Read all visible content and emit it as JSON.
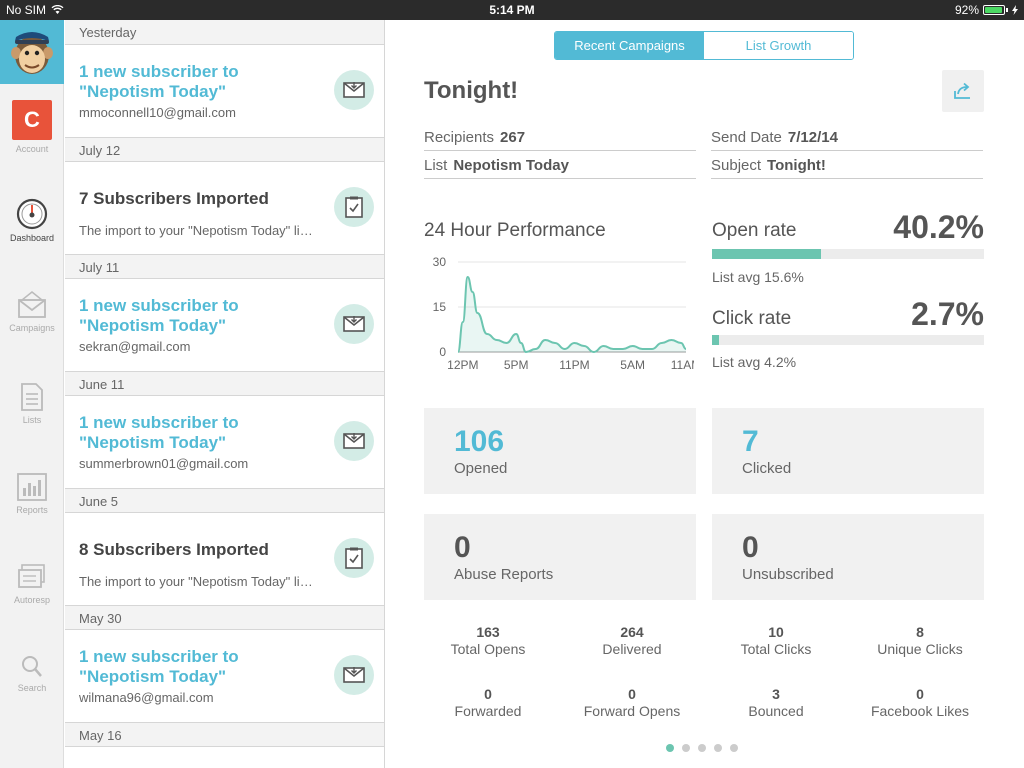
{
  "status_bar": {
    "carrier": "No SIM",
    "time": "5:14 PM",
    "battery": "92%",
    "battery_level": 0.92
  },
  "nav": {
    "account_initial": "C",
    "items": [
      {
        "label": "Account",
        "icon": "account-icon"
      },
      {
        "label": "Dashboard",
        "icon": "dashboard-gauge-icon",
        "active": true
      },
      {
        "label": "Campaigns",
        "icon": "campaigns-icon"
      },
      {
        "label": "Lists",
        "icon": "lists-icon"
      },
      {
        "label": "Reports",
        "icon": "reports-icon"
      },
      {
        "label": "Autoresp",
        "icon": "autoresponder-icon"
      },
      {
        "label": "Search",
        "icon": "search-icon"
      }
    ]
  },
  "activity": {
    "sections": [
      {
        "header": "Yesterday",
        "item": {
          "type": "subscriber",
          "title": "1 new subscriber to \"Nepotism Today\"",
          "sub": "mmoconnell10@gmail.com"
        }
      },
      {
        "header": "July 12",
        "item": {
          "type": "import",
          "title": "7 Subscribers Imported",
          "sub": "The import to your \"Nepotism Today\" list..."
        }
      },
      {
        "header": "July 11",
        "item": {
          "type": "subscriber",
          "title": "1 new subscriber to \"Nepotism Today\"",
          "sub": "sekran@gmail.com"
        }
      },
      {
        "header": "June 11",
        "item": {
          "type": "subscriber",
          "title": "1 new subscriber to \"Nepotism Today\"",
          "sub": "summerbrown01@gmail.com"
        }
      },
      {
        "header": "June 5",
        "item": {
          "type": "import",
          "title": "8 Subscribers Imported",
          "sub": "The import to your \"Nepotism Today\" list..."
        }
      },
      {
        "header": "May 30",
        "item": {
          "type": "subscriber",
          "title": "1 new subscriber to \"Nepotism Today\"",
          "sub": "wilmana96@gmail.com"
        }
      },
      {
        "header": "May 16"
      }
    ]
  },
  "tabs": {
    "recent": "Recent Campaigns",
    "growth": "List Growth"
  },
  "campaign": {
    "title": "Tonight!",
    "recipients_label": "Recipients",
    "recipients": "267",
    "list_label": "List",
    "list": "Nepotism Today",
    "send_date_label": "Send Date",
    "send_date": "7/12/14",
    "subject_label": "Subject",
    "subject": "Tonight!"
  },
  "performance": {
    "title": "24 Hour Performance",
    "open_rate": {
      "label": "Open rate",
      "value": "40.2%",
      "fraction": 0.402,
      "avg": "List avg 15.6%"
    },
    "click_rate": {
      "label": "Click rate",
      "value": "2.7%",
      "fraction": 0.027,
      "avg": "List avg 4.2%"
    }
  },
  "chart_data": {
    "type": "area",
    "x": [
      0,
      0.5,
      1,
      1.5,
      2,
      3,
      4,
      5,
      6,
      6.5,
      7,
      8,
      9,
      10,
      11,
      12,
      13,
      14,
      15,
      16,
      17,
      18,
      19,
      20,
      21,
      22,
      23,
      23.5
    ],
    "values": [
      0,
      10,
      25,
      20,
      13,
      6,
      4,
      3,
      6,
      3,
      0,
      1,
      4,
      3,
      1,
      3,
      2,
      0,
      2,
      1,
      1,
      2,
      1,
      1,
      3,
      4,
      3,
      1
    ],
    "x_ticks": [
      "12PM",
      "5PM",
      "11PM",
      "5AM",
      "11AM"
    ],
    "y_ticks": [
      "30",
      "15",
      "0"
    ],
    "ylim": [
      0,
      30
    ],
    "color": "#6cc5b0"
  },
  "cards": [
    {
      "value": "106",
      "label": "Opened",
      "accent": true
    },
    {
      "value": "7",
      "label": "Clicked",
      "accent": true
    },
    {
      "value": "0",
      "label": "Abuse Reports",
      "accent": false
    },
    {
      "value": "0",
      "label": "Unsubscribed",
      "accent": false
    }
  ],
  "stats": [
    {
      "value": "163",
      "label": "Total Opens"
    },
    {
      "value": "264",
      "label": "Delivered"
    },
    {
      "value": "10",
      "label": "Total Clicks"
    },
    {
      "value": "8",
      "label": "Unique Clicks"
    },
    {
      "value": "0",
      "label": "Forwarded"
    },
    {
      "value": "0",
      "label": "Forward Opens"
    },
    {
      "value": "3",
      "label": "Bounced"
    },
    {
      "value": "0",
      "label": "Facebook Likes"
    }
  ],
  "pager": {
    "pages": 5,
    "active": 0
  },
  "colors": {
    "brand_blue": "#52bad5",
    "teal": "#6cc5b0",
    "account_red": "#e8533a"
  }
}
